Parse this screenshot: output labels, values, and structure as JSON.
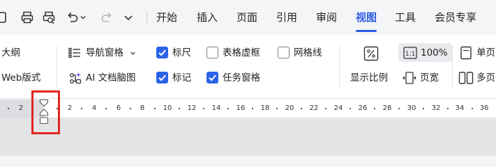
{
  "quick_access": {
    "icons": [
      "print-icon",
      "print-preview-icon",
      "undo-icon",
      "undo-dropdown-icon",
      "redo-icon",
      "more-chevron-icon"
    ]
  },
  "tabs": [
    {
      "label": "开始"
    },
    {
      "label": "插入"
    },
    {
      "label": "页面"
    },
    {
      "label": "引用"
    },
    {
      "label": "审阅"
    },
    {
      "label": "视图",
      "active": true
    },
    {
      "label": "工具"
    },
    {
      "label": "会员专享"
    }
  ],
  "ribbon": {
    "left_partial": {
      "outline": "大纲",
      "web_layout": "Web版式"
    },
    "nav_pane": "导航窗格",
    "ai_mindmap": "AI 文档脑图",
    "checks": {
      "ruler": {
        "label": "标尺",
        "checked": true
      },
      "table_gridlines": {
        "label": "表格虚框",
        "checked": false
      },
      "gridlines": {
        "label": "网格线",
        "checked": false
      },
      "marks": {
        "label": "标记",
        "checked": true
      },
      "task_pane": {
        "label": "任务窗格",
        "checked": true
      }
    },
    "zoom": {
      "display_ratio": "显示比例",
      "percent": "100%",
      "page_width": "页宽"
    },
    "view": {
      "single_page": "单页",
      "multi_page": "多页"
    }
  },
  "ruler": {
    "labels": [
      "2",
      "2",
      "4",
      "6",
      "8",
      "10",
      "12",
      "14",
      "16",
      "18",
      "20",
      "22",
      "24",
      "26",
      "28",
      "30",
      "32",
      "34",
      "36"
    ]
  },
  "colors": {
    "accent": "#2b5be6",
    "checkbox": "#2b63e8",
    "highlight": "#e1261c"
  }
}
